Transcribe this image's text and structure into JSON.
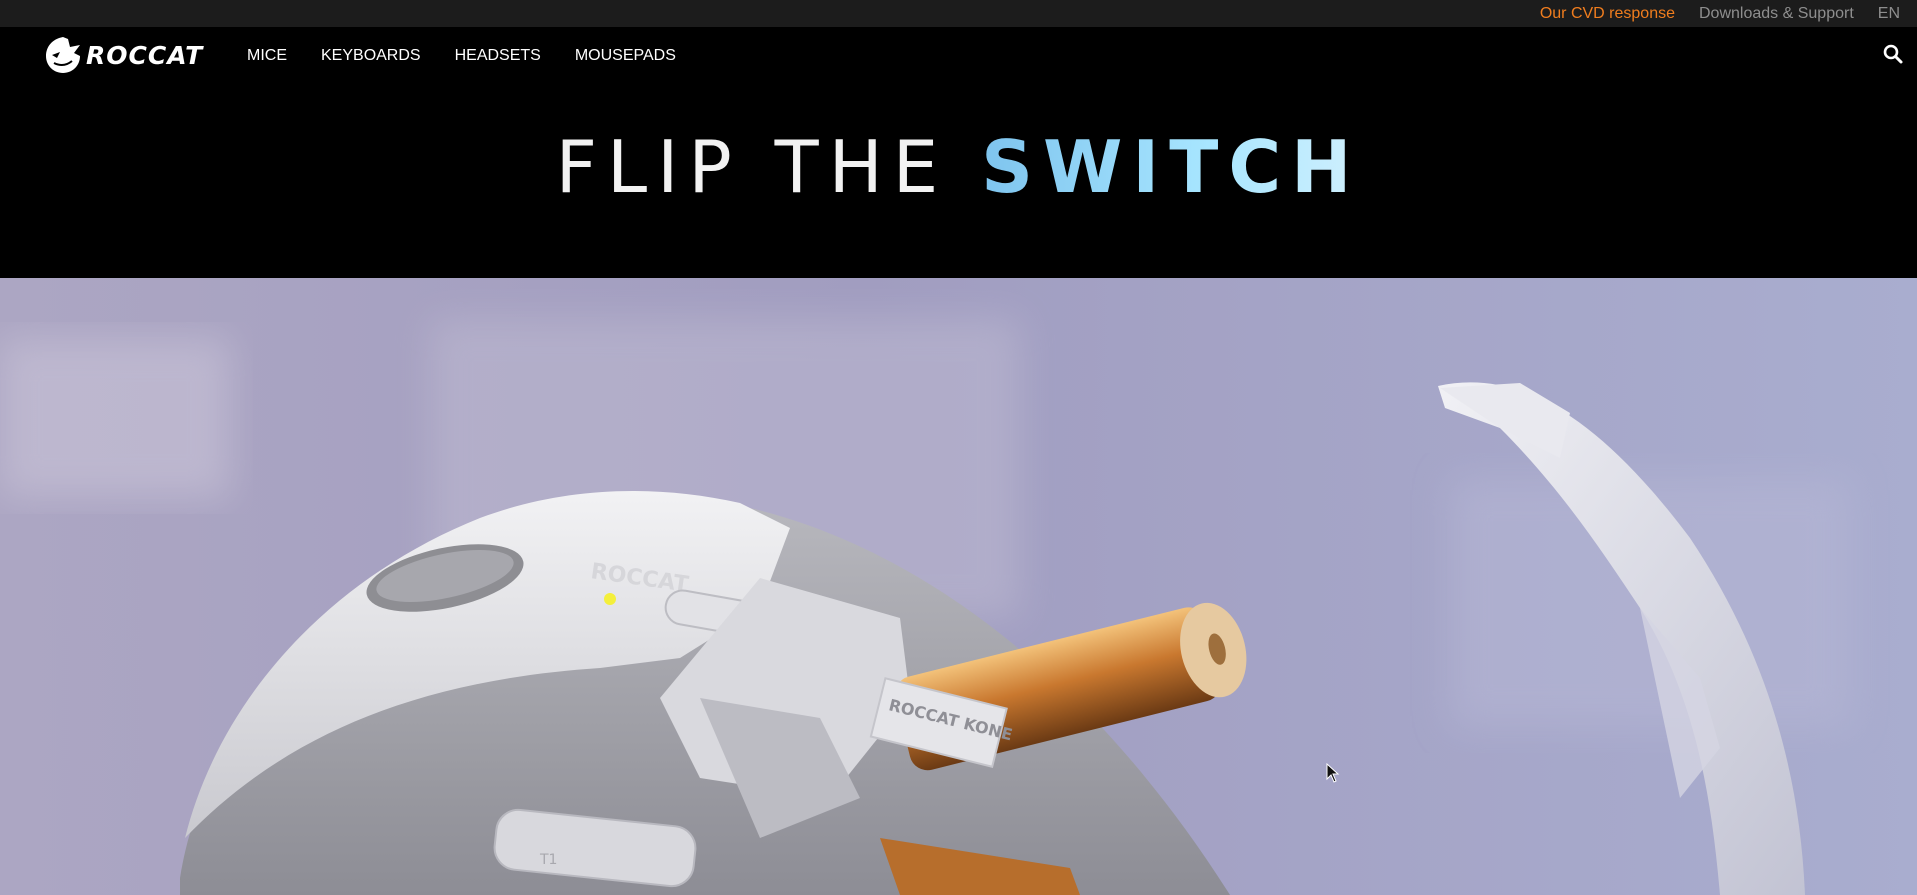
{
  "topbar": {
    "cvd_link": "Our CVD response",
    "support_link": "Downloads & Support",
    "language": "EN"
  },
  "nav": {
    "logo_text": "ROCCAT",
    "items": [
      {
        "label": "MICE"
      },
      {
        "label": "KEYBOARDS"
      },
      {
        "label": "HEADSETS"
      },
      {
        "label": "MOUSEPADS"
      }
    ],
    "search_icon": "search-icon"
  },
  "hero": {
    "headline_light": "FLIP THE ",
    "headline_accent": "SWITCH"
  },
  "product_image": {
    "mouse_brand_text": "ROCCAT",
    "battery_cap_text": "ROCCAT KONE",
    "button_text": "T1"
  },
  "colors": {
    "cvd_link": "#f07d1e",
    "support_link": "#8e8e8e",
    "accent": "#a8e6ff",
    "nav_bg": "#000000",
    "topbar_bg": "#1c1c1c"
  }
}
